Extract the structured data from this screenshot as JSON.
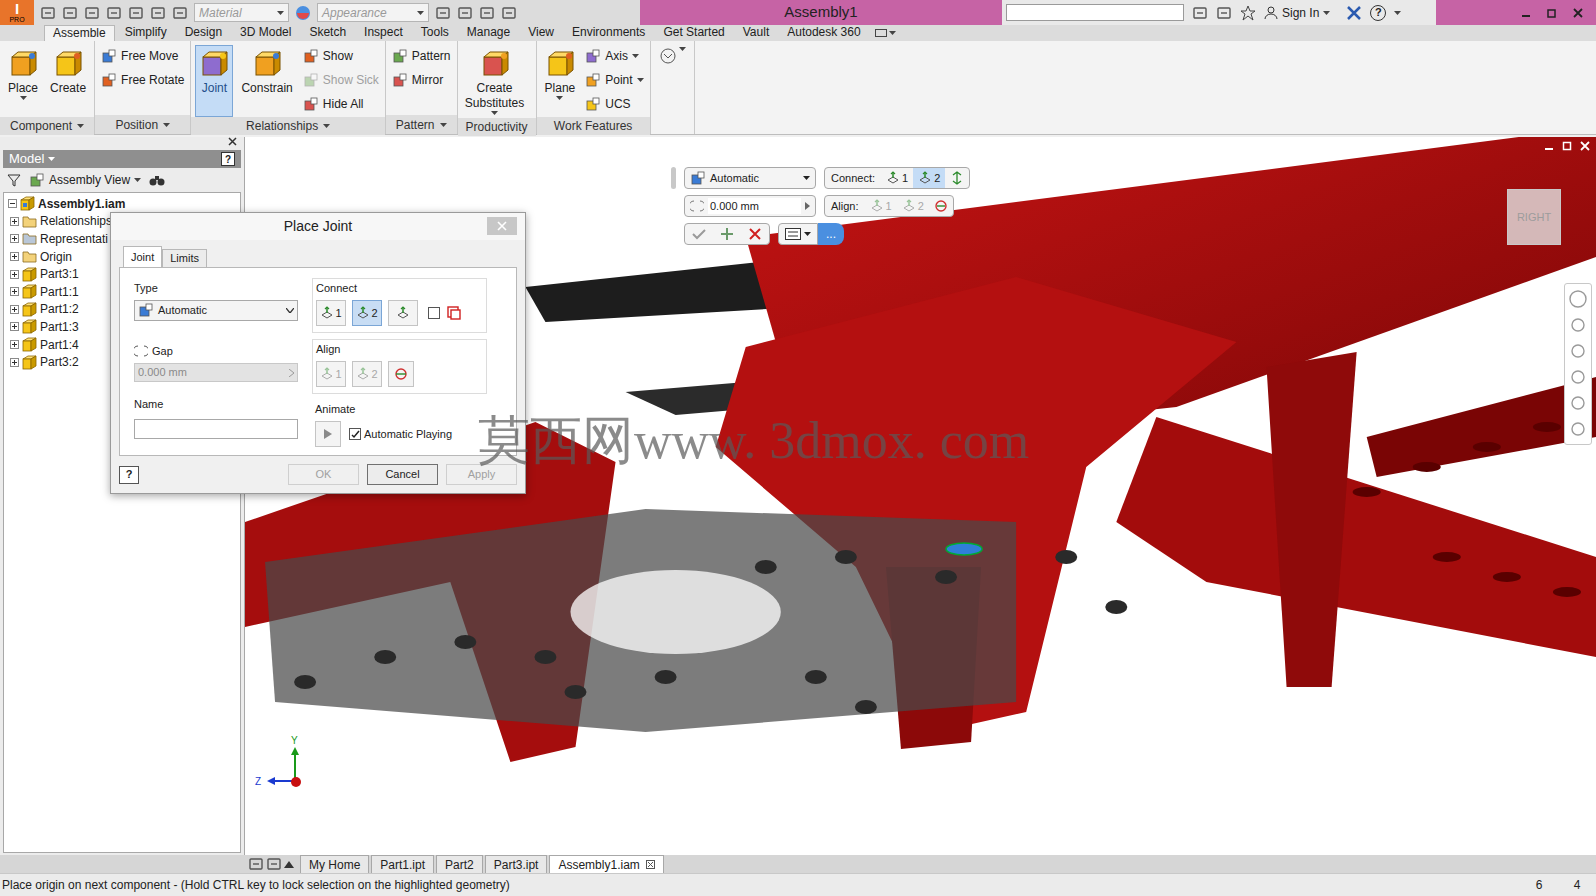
{
  "app": {
    "logo": "I",
    "edition": "PRO"
  },
  "window": {
    "title": "Assembly1"
  },
  "quick_access": {
    "material": "Material",
    "appearance": "Appearance"
  },
  "account": {
    "sign_in": "Sign In",
    "help": "?"
  },
  "menu_tabs": [
    {
      "label": "Assemble",
      "selected": true
    },
    {
      "label": "Simplify",
      "selected": false
    },
    {
      "label": "Design",
      "selected": false
    },
    {
      "label": "3D Model",
      "selected": false
    },
    {
      "label": "Sketch",
      "selected": false
    },
    {
      "label": "Inspect",
      "selected": false
    },
    {
      "label": "Tools",
      "selected": false
    },
    {
      "label": "Manage",
      "selected": false
    },
    {
      "label": "View",
      "selected": false
    },
    {
      "label": "Environments",
      "selected": false
    },
    {
      "label": "Get Started",
      "selected": false
    },
    {
      "label": "Vault",
      "selected": false
    },
    {
      "label": "Autodesk 360",
      "selected": false
    }
  ],
  "ribbon_groups": [
    {
      "label": "Component",
      "dropdown": true,
      "items": [
        {
          "label": "Place",
          "kind": "large",
          "selected": false,
          "disabled": false,
          "dropdown": true
        },
        {
          "label": "Create",
          "kind": "large",
          "selected": false,
          "disabled": false,
          "dropdown": false
        }
      ]
    },
    {
      "label": "Position",
      "dropdown": true,
      "items": [
        {
          "label": "Free Move",
          "kind": "small",
          "selected": false,
          "disabled": false,
          "dropdown": false
        },
        {
          "label": "Free Rotate",
          "kind": "small",
          "selected": false,
          "disabled": false,
          "dropdown": false
        }
      ]
    },
    {
      "label": "Relationships",
      "dropdown": true,
      "items": [
        {
          "label": "Joint",
          "kind": "large",
          "selected": true,
          "disabled": false,
          "dropdown": false
        },
        {
          "label": "Constrain",
          "kind": "large",
          "selected": false,
          "disabled": false,
          "dropdown": false
        },
        {
          "label": "Show",
          "kind": "small",
          "selected": false,
          "disabled": false,
          "dropdown": false
        },
        {
          "label": "Show Sick",
          "kind": "small",
          "selected": false,
          "disabled": true,
          "dropdown": false
        },
        {
          "label": "Hide All",
          "kind": "small",
          "selected": false,
          "disabled": false,
          "dropdown": false
        }
      ]
    },
    {
      "label": "Pattern",
      "dropdown": true,
      "items": [
        {
          "label": "Pattern",
          "kind": "small",
          "selected": false,
          "disabled": false,
          "dropdown": false
        },
        {
          "label": "Mirror",
          "kind": "small",
          "selected": false,
          "disabled": false,
          "dropdown": false
        }
      ]
    },
    {
      "label": "Productivity",
      "dropdown": false,
      "items": [
        {
          "label": "Create Substitutes",
          "kind": "large",
          "selected": false,
          "disabled": false,
          "dropdown": true
        }
      ]
    },
    {
      "label": "Work Features",
      "dropdown": false,
      "items": [
        {
          "label": "Plane",
          "kind": "large",
          "selected": false,
          "disabled": false,
          "dropdown": true
        },
        {
          "label": "Axis",
          "kind": "small",
          "selected": false,
          "disabled": false,
          "dropdown": true
        },
        {
          "label": "Point",
          "kind": "small",
          "selected": false,
          "disabled": false,
          "dropdown": true
        },
        {
          "label": "UCS",
          "kind": "small",
          "selected": false,
          "disabled": false,
          "dropdown": false
        }
      ]
    }
  ],
  "browser": {
    "header": "Model",
    "help": "?",
    "view": "Assembly View",
    "tree": [
      {
        "label": "Assembly1.iam",
        "kind": "assembly",
        "expanded": true,
        "bold": true
      },
      {
        "label": "Relationships",
        "kind": "folder",
        "expanded": false,
        "bold": false
      },
      {
        "label": "Representati",
        "kind": "representations",
        "expanded": false,
        "bold": false
      },
      {
        "label": "Origin",
        "kind": "folder",
        "expanded": false,
        "bold": false
      },
      {
        "label": "Part3:1",
        "kind": "part",
        "expanded": false,
        "bold": false
      },
      {
        "label": "Part1:1",
        "kind": "part",
        "expanded": false,
        "bold": false
      },
      {
        "label": "Part1:2",
        "kind": "part",
        "expanded": false,
        "bold": false
      },
      {
        "label": "Part1:3",
        "kind": "part",
        "expanded": false,
        "bold": false
      },
      {
        "label": "Part1:4",
        "kind": "part",
        "expanded": false,
        "bold": false
      },
      {
        "label": "Part3:2",
        "kind": "part",
        "expanded": false,
        "bold": false
      }
    ]
  },
  "joint_toolbar": {
    "type": "Automatic",
    "connect_label": "Connect:",
    "connect": [
      {
        "label": "1",
        "selected": false
      },
      {
        "label": "2",
        "selected": true
      }
    ],
    "gap": "0.000 mm",
    "align_label": "Align:",
    "align": [
      {
        "label": "1",
        "disabled": true
      },
      {
        "label": "2",
        "disabled": true
      }
    ],
    "more": "..."
  },
  "dialog": {
    "title": "Place Joint",
    "tabs": [
      {
        "label": "Joint",
        "selected": true
      },
      {
        "label": "Limits",
        "selected": false
      }
    ],
    "type_label": "Type",
    "type": "Automatic",
    "gap_label": "Gap",
    "gap": "0.000 mm",
    "gap_disabled": true,
    "name_label": "Name",
    "name": "",
    "connect_label": "Connect",
    "connect": [
      {
        "label": "1",
        "selected": false
      },
      {
        "label": "2",
        "selected": true
      }
    ],
    "flip_checked": false,
    "align_label": "Align",
    "align": [
      {
        "label": "1",
        "disabled": true
      },
      {
        "label": "2",
        "disabled": true
      }
    ],
    "animate_label": "Animate",
    "automatic_playing": {
      "label": "Automatic Playing",
      "checked": true
    },
    "help": "?",
    "buttons": [
      {
        "label": "OK",
        "disabled": true
      },
      {
        "label": "Cancel",
        "disabled": false
      },
      {
        "label": "Apply",
        "disabled": true
      }
    ]
  },
  "viewcube": "RIGHT",
  "axes": {
    "y": "Y",
    "z": "Z"
  },
  "watermark": "莫西网www. 3dmox. com",
  "document_tabs": [
    {
      "label": "My Home",
      "selected": false,
      "closable": false
    },
    {
      "label": "Part1.ipt",
      "selected": false,
      "closable": false
    },
    {
      "label": "Part2",
      "selected": false,
      "closable": false
    },
    {
      "label": "Part3.ipt",
      "selected": false,
      "closable": false
    },
    {
      "label": "Assembly1.iam",
      "selected": true,
      "closable": true
    }
  ],
  "status_bar": {
    "message": "Place origin on next component - (Hold CTRL key to lock selection on the highlighted geometry)",
    "values": [
      "6",
      "4"
    ]
  }
}
